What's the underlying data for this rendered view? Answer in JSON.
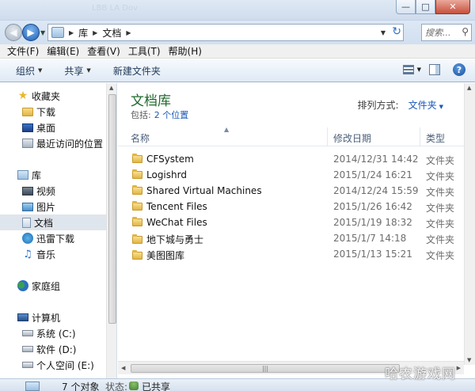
{
  "window": {
    "ghost_title": "LBB LA Dov"
  },
  "address": {
    "crumbs": [
      "库",
      "文档"
    ]
  },
  "search": {
    "placeholder": "搜索..."
  },
  "menu": [
    "文件(F)",
    "编辑(E)",
    "查看(V)",
    "工具(T)",
    "帮助(H)"
  ],
  "toolbar": {
    "organize": "组织",
    "share": "共享",
    "new_folder": "新建文件夹"
  },
  "nav": {
    "favorites": {
      "label": "收藏夹",
      "items": [
        "下载",
        "桌面",
        "最近访问的位置"
      ]
    },
    "libraries": {
      "label": "库",
      "items": [
        "视频",
        "图片",
        "文档",
        "迅雷下载",
        "音乐"
      ]
    },
    "homegroup": "家庭组",
    "computer": {
      "label": "计算机",
      "items": [
        "系统 (C:)",
        "软件 (D:)",
        "个人空间 (E:)"
      ]
    }
  },
  "library": {
    "title": "文档库",
    "includes_label": "包括:",
    "includes_link": "2 个位置",
    "arrange_label": "排列方式:",
    "arrange_value": "文件夹"
  },
  "columns": {
    "name": "名称",
    "date": "修改日期",
    "type": "类型"
  },
  "files": [
    {
      "name": "CFSystem",
      "date": "2014/12/31 14:42",
      "type": "文件夹"
    },
    {
      "name": "Logishrd",
      "date": "2015/1/24 16:21",
      "type": "文件夹"
    },
    {
      "name": "Shared Virtual Machines",
      "date": "2014/12/24 15:59",
      "type": "文件夹"
    },
    {
      "name": "Tencent Files",
      "date": "2015/1/26 16:42",
      "type": "文件夹"
    },
    {
      "name": "WeChat Files",
      "date": "2015/1/19 18:32",
      "type": "文件夹"
    },
    {
      "name": "地下城与勇士",
      "date": "2015/1/7 14:18",
      "type": "文件夹"
    },
    {
      "name": "美图图库",
      "date": "2015/1/13 15:21",
      "type": "文件夹"
    }
  ],
  "status": {
    "count": "7 个对象",
    "state_label": "状态:",
    "state_value": "已共享"
  },
  "watermark": "哈农游戏网"
}
